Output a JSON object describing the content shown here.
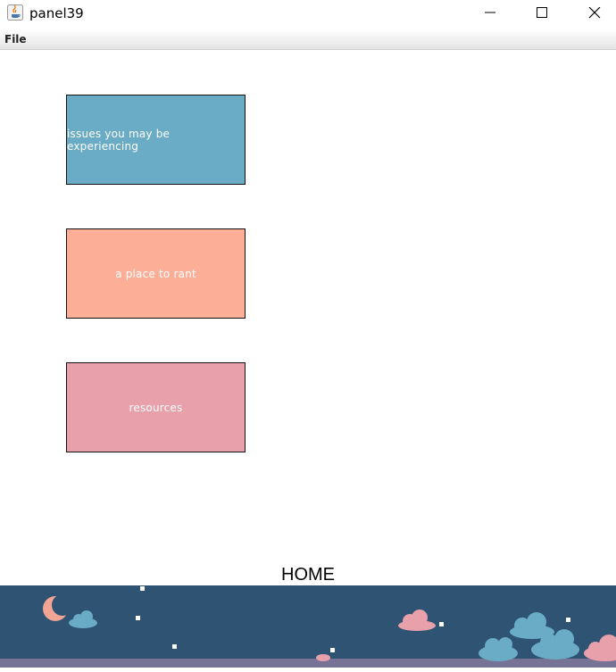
{
  "window": {
    "title": "panel39",
    "controls": [
      "minimize-icon",
      "maximize-icon",
      "close-icon"
    ]
  },
  "menu": {
    "items": [
      "File"
    ]
  },
  "buttons": [
    {
      "label": "issues you may be experiencing",
      "color": "#6aabc6"
    },
    {
      "label": "a place to rant",
      "color": "#fdae97"
    },
    {
      "label": "resources",
      "color": "#e8a0aa"
    }
  ],
  "home": {
    "label": "HOME"
  },
  "footer": {
    "background": "#2f5473",
    "ground": "#777396",
    "icons": [
      "moon-icon",
      "cloud-icon",
      "star-icon"
    ]
  }
}
